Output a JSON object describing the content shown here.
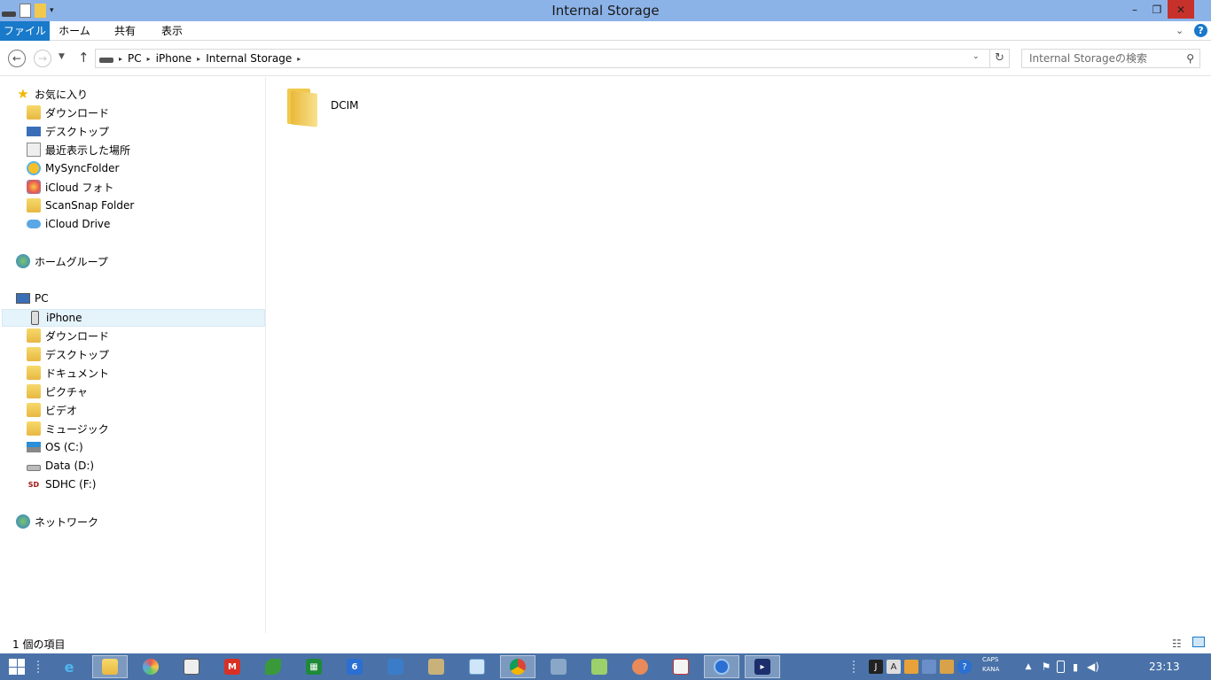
{
  "window": {
    "title": "Internal Storage",
    "minimize": "–",
    "restore": "❐",
    "close": "✕"
  },
  "ribbon": {
    "file": "ファイル",
    "home": "ホーム",
    "share": "共有",
    "view": "表示",
    "expand": "⌄",
    "help": "?"
  },
  "address": {
    "back": "←",
    "forward": "→",
    "recent": "▼",
    "up": "↑",
    "crumbs": [
      "PC",
      "iPhone",
      "Internal Storage"
    ],
    "separator": "▸",
    "dropdown": "⌄",
    "refresh": "↻"
  },
  "search": {
    "placeholder": "Internal Storageの検索",
    "icon": "⚲"
  },
  "nav": {
    "favorites": {
      "label": "お気に入り",
      "items": [
        "ダウンロード",
        "デスクトップ",
        "最近表示した場所",
        "MySyncFolder",
        "iCloud フォト",
        "ScanSnap Folder",
        "iCloud Drive"
      ]
    },
    "homegroup": {
      "label": "ホームグループ"
    },
    "pc": {
      "label": "PC",
      "items": [
        "iPhone",
        "ダウンロード",
        "デスクトップ",
        "ドキュメント",
        "ピクチャ",
        "ビデオ",
        "ミュージック",
        "OS (C:)",
        "Data (D:)",
        "SDHC (F:)"
      ]
    },
    "network": {
      "label": "ネットワーク"
    }
  },
  "content": {
    "items": [
      {
        "name": "DCIM",
        "type": "folder"
      }
    ]
  },
  "status": {
    "count": "1 個の項目"
  },
  "taskbar": {
    "caps": "CAPS",
    "kana": "KANA",
    "calendar_day": "6",
    "clock": "23:13"
  },
  "colors": {
    "titlebar": "#8cb3e8",
    "file_tab": "#1979ca",
    "close": "#c7312b",
    "taskbar": "#4a72a8",
    "selected": "#e5f3fb"
  }
}
